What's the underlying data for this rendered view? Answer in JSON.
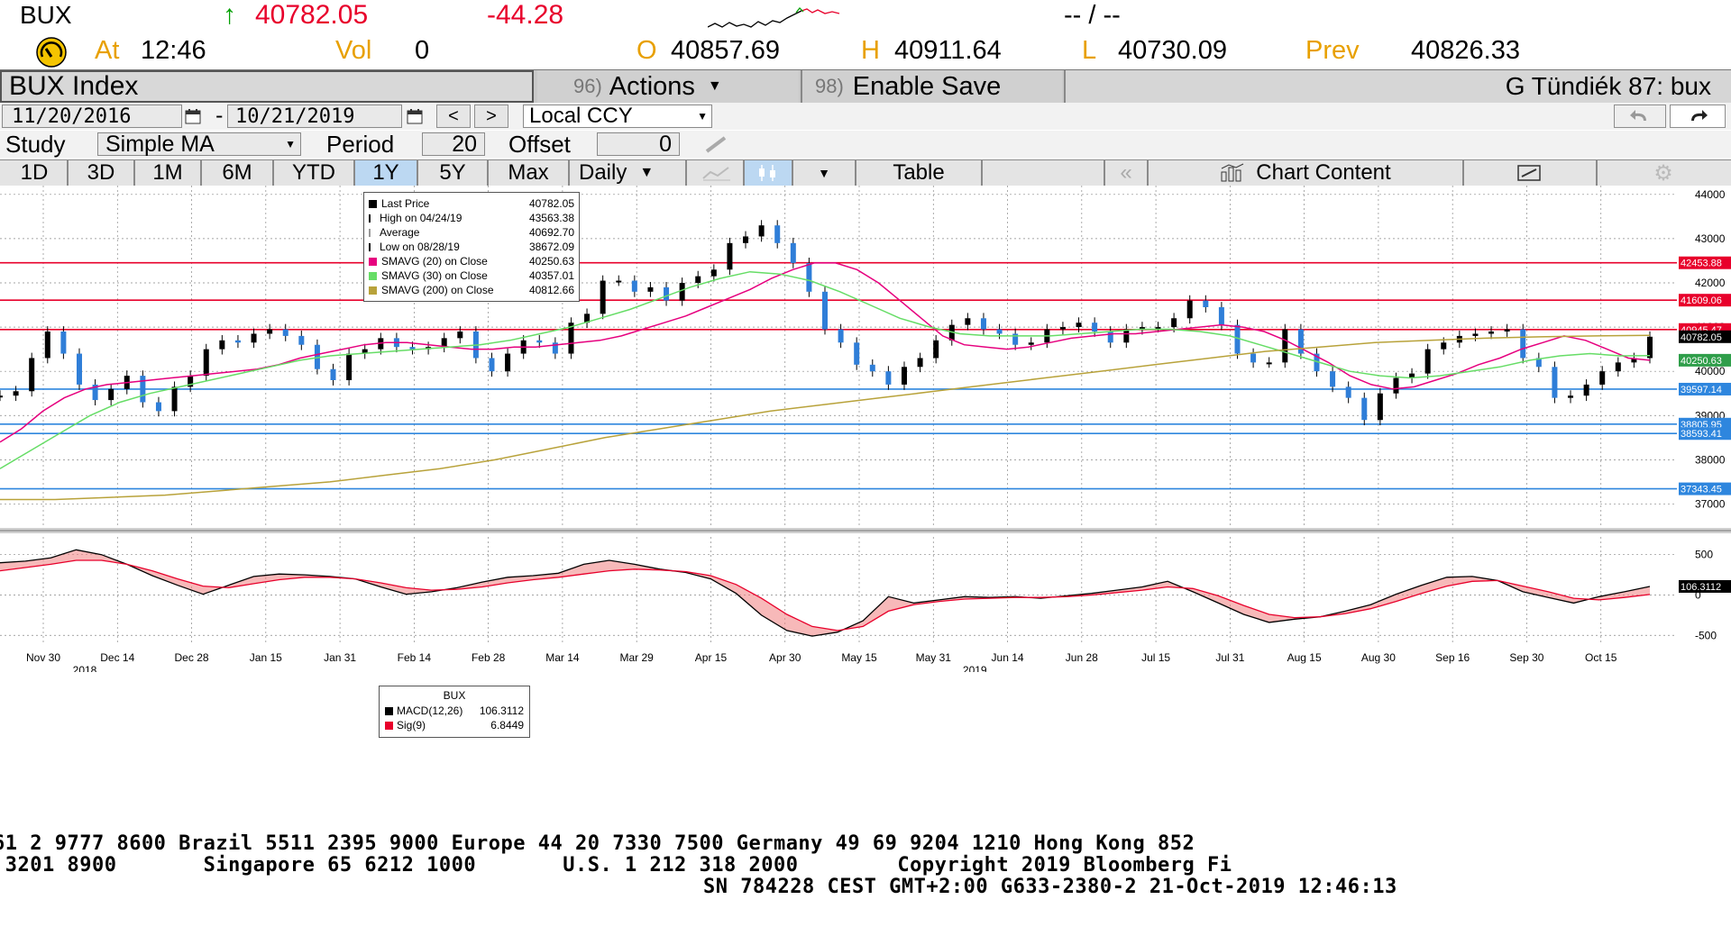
{
  "quote": {
    "ticker": "BUX",
    "arrow": "↑",
    "last": "40782.05",
    "change": "-44.28",
    "bid_ask": "-- / --",
    "at_label": "At",
    "time": "12:46",
    "vol_label": "Vol",
    "vol": "0",
    "open_label": "O",
    "open": "40857.69",
    "high_label": "H",
    "high": "40911.64",
    "low_label": "L",
    "low": "40730.09",
    "prev_label": "Prev",
    "prev": "40826.33"
  },
  "menu": {
    "security": "BUX Index",
    "actions_num": "96)",
    "actions_label": "Actions",
    "save_num": "98)",
    "save_label": "Enable Save",
    "user": "G Tündiék 87: bux"
  },
  "dates": {
    "start": "11/20/2016",
    "dash": "-",
    "end": "10/21/2019",
    "prev_arrow": "<",
    "next_arrow": ">",
    "currency": "Local CCY"
  },
  "study": {
    "label": "Study",
    "value": "Simple MA",
    "period_label": "Period",
    "period": "20",
    "offset_label": "Offset",
    "offset": "0"
  },
  "tabs": {
    "periods": [
      "1D",
      "3D",
      "1M",
      "6M",
      "YTD",
      "1Y",
      "5Y",
      "Max"
    ],
    "active": "1Y",
    "frequency": "Daily",
    "table": "Table",
    "chart_content": "Chart Content"
  },
  "colors": {
    "up": "#2f7ed8",
    "down": "#2f7ed8",
    "price": "#000000",
    "sma20": "#e6007e",
    "sma30": "#66dd66",
    "sma200": "#b8a23a",
    "red_line": "#e8002b",
    "blue_line": "#2e86de",
    "macd_fill": "#f08080",
    "quote_up": "#00a000",
    "quote_down": "#e8002b",
    "tab_active": "#bcd8f2"
  },
  "legend": {
    "rows": [
      {
        "label": "Last Price",
        "value": "40782.05"
      },
      {
        "label": "High on 04/24/19",
        "value": "43563.38"
      },
      {
        "label": "Average",
        "value": "40692.70"
      },
      {
        "label": "Low on 08/28/19",
        "value": "38672.09"
      },
      {
        "label": "SMAVG (20)  on Close",
        "value": "40250.63"
      },
      {
        "label": "SMAVG (30)  on Close",
        "value": "40357.01"
      },
      {
        "label": "SMAVG (200)  on Close",
        "value": "40812.66"
      }
    ]
  },
  "macd_legend": {
    "title": "BUX",
    "rows": [
      {
        "label": "MACD(12,26)",
        "value": "106.3112"
      },
      {
        "label": "Sig(9)",
        "value": "6.8449"
      }
    ]
  },
  "footer": {
    "line1": "61 2 9777 8600 Brazil 5511 2395 9000 Europe 44 20 7330 7500 Germany 49 69 9204 1210 Hong Kong 852",
    "line2": " 3201 8900       Singapore 65 6212 1000       U.S. 1 212 318 2000        Copyright 2019 Bloomberg Fi",
    "line3": "SN 784228 CEST GMT+2:00 G633-2380-2 21-Oct-2019 12:46:13"
  },
  "chart_data": [
    {
      "type": "line",
      "title": "BUX Index",
      "y_ticks": [
        37000,
        38000,
        39000,
        40000,
        41000,
        42000,
        43000,
        44000
      ],
      "ylim": [
        36500,
        44200
      ],
      "x_tick_labels": [
        "Nov 30",
        "Dec 14",
        "Dec 28",
        "Jan 15",
        "Jan 31",
        "Feb 14",
        "Feb 28",
        "Mar 14",
        "Mar 29",
        "Apr 15",
        "Apr 30",
        "May 15",
        "May 31",
        "Jun 14",
        "Jun 28",
        "Jul 15",
        "Jul 31",
        "Aug 15",
        "Aug 30",
        "Sep 16",
        "Sep 30",
        "Oct 15"
      ],
      "year_labels": [
        "2018",
        "2019"
      ],
      "grid": true,
      "horizontal_levels": [
        {
          "value": 42453.88,
          "label": "42453.88",
          "color": "red"
        },
        {
          "value": 41609.06,
          "label": "41609.06",
          "color": "red"
        },
        {
          "value": 40945.47,
          "label": "40945.47",
          "color": "red"
        },
        {
          "value": 39597.14,
          "label": "39597.14",
          "color": "blue"
        },
        {
          "value": 38805.95,
          "label": "38805.95",
          "color": "blue"
        },
        {
          "value": 38593.41,
          "label": "38593.41",
          "color": "blue"
        },
        {
          "value": 37343.45,
          "label": "37343.45",
          "color": "blue"
        }
      ],
      "axis_value_labels": [
        {
          "value": 40782.05,
          "label": "40782.05"
        },
        {
          "value": 40250.63,
          "label": "40250.63"
        }
      ],
      "series": [
        {
          "name": "Last Price",
          "values": [
            39450,
            39550,
            40300,
            40900,
            40400,
            39700,
            39350,
            39600,
            39900,
            39300,
            39100,
            39650,
            39900,
            40500,
            40700,
            40650,
            40850,
            40950,
            40800,
            40600,
            40050,
            39800,
            40400,
            40500,
            40750,
            40550,
            40500,
            40550,
            40750,
            40900,
            40300,
            40000,
            40400,
            40700,
            40650,
            40400,
            41100,
            41300,
            42050,
            42050,
            41800,
            41900,
            41600,
            42000,
            42150,
            42300,
            42900,
            43050,
            43300,
            42900,
            42450,
            41800,
            40950,
            40650,
            40150,
            40000,
            39700,
            40100,
            40300,
            40700,
            41050,
            41200,
            40950,
            40850,
            40600,
            40650,
            40950,
            41000,
            41100,
            40900,
            40650,
            40950,
            41000,
            41000,
            41200,
            41600,
            41450,
            41050,
            40400,
            40200,
            40200,
            40950,
            40400,
            40000,
            39650,
            39400,
            38900,
            39500,
            39850,
            39950,
            40500,
            40650,
            40800,
            40850,
            40900,
            40950,
            40300,
            40100,
            39400,
            39450,
            39700,
            40000,
            40200,
            40300,
            40782
          ]
        },
        {
          "name": "SMAVG (20)",
          "values": [
            38400,
            38700,
            39100,
            39400,
            39600,
            39700,
            39750,
            39800,
            39850,
            39900,
            39950,
            40000,
            40050,
            40150,
            40300,
            40400,
            40500,
            40600,
            40650,
            40650,
            40600,
            40550,
            40500,
            40500,
            40550,
            40550,
            40600,
            40650,
            40700,
            40800,
            40950,
            41100,
            41250,
            41450,
            41650,
            41850,
            42100,
            42300,
            42450,
            42450,
            42300,
            42000,
            41600,
            41200,
            40800,
            40600,
            40550,
            40500,
            40550,
            40650,
            40750,
            40800,
            40850,
            40850,
            40900,
            40950,
            41000,
            41050,
            41000,
            40900,
            40700,
            40450,
            40200,
            39900,
            39700,
            39600,
            39650,
            39800,
            39950,
            40150,
            40300,
            40500,
            40650,
            40800,
            40700,
            40500,
            40300,
            40250
          ]
        },
        {
          "name": "SMAVG (30)",
          "values": [
            37800,
            38200,
            38600,
            39000,
            39300,
            39500,
            39650,
            39800,
            39950,
            40100,
            40250,
            40350,
            40400,
            40450,
            40500,
            40550,
            40600,
            40700,
            40850,
            41000,
            41200,
            41400,
            41650,
            41900,
            42100,
            42250,
            42200,
            42050,
            41800,
            41500,
            41200,
            41000,
            40850,
            40800,
            40800,
            40800,
            40850,
            40900,
            40950,
            40950,
            40900,
            40800,
            40600,
            40400,
            40200,
            40000,
            39900,
            39850,
            39900,
            40000,
            40100,
            40250,
            40350,
            40400,
            40350,
            40357
          ]
        },
        {
          "name": "SMAVG (200)",
          "values": [
            37100,
            37100,
            37150,
            37200,
            37300,
            37400,
            37500,
            37650,
            37800,
            38000,
            38250,
            38500,
            38700,
            38900,
            39100,
            39250,
            39400,
            39550,
            39700,
            39850,
            40000,
            40150,
            40300,
            40450,
            40550,
            40650,
            40700,
            40750,
            40780,
            40800,
            40812
          ]
        }
      ]
    },
    {
      "type": "line",
      "title": "BUX",
      "y_ticks": [
        -500,
        0,
        500
      ],
      "ylim": [
        -620,
        720
      ],
      "series": [
        {
          "name": "MACD(12,26)",
          "values": [
            400,
            420,
            460,
            560,
            500,
            380,
            240,
            120,
            10,
            120,
            230,
            260,
            250,
            230,
            200,
            100,
            10,
            40,
            90,
            160,
            220,
            240,
            270,
            380,
            430,
            380,
            320,
            280,
            200,
            20,
            -250,
            -440,
            -510,
            -460,
            -320,
            -20,
            -100,
            -60,
            -20,
            -30,
            -20,
            -40,
            -10,
            20,
            60,
            100,
            170,
            40,
            -100,
            -240,
            -340,
            -300,
            -270,
            -200,
            -120,
            10,
            120,
            220,
            230,
            180,
            40,
            -30,
            -100,
            -20,
            40,
            106.3112
          ]
        },
        {
          "name": "Sig(9)",
          "values": [
            300,
            340,
            380,
            430,
            430,
            380,
            300,
            200,
            110,
            90,
            140,
            190,
            220,
            220,
            200,
            150,
            90,
            60,
            70,
            100,
            150,
            190,
            220,
            260,
            300,
            320,
            310,
            290,
            240,
            130,
            -40,
            -240,
            -390,
            -440,
            -390,
            -200,
            -120,
            -80,
            -50,
            -40,
            -30,
            -30,
            -20,
            0,
            30,
            60,
            100,
            80,
            -10,
            -130,
            -240,
            -280,
            -270,
            -230,
            -170,
            -80,
            20,
            110,
            170,
            180,
            110,
            40,
            -40,
            -60,
            -30,
            6.8449
          ]
        }
      ]
    }
  ]
}
